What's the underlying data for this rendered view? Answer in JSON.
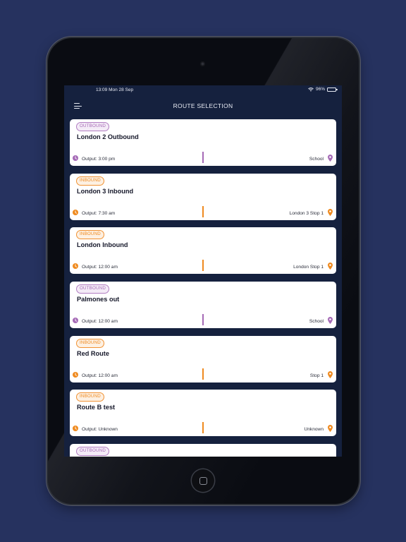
{
  "status_bar": {
    "time": "13:09  Mon 28 Sep",
    "battery": "96%"
  },
  "header": {
    "title": "ROUTE SELECTION"
  },
  "colors": {
    "background": "#26325f",
    "screen": "#15213e",
    "outbound": "#a56ab6",
    "inbound": "#ef8a1f"
  },
  "routes": [
    {
      "direction": "outbound",
      "badge": "OUTBOUND",
      "name": "London 2 Outbound",
      "output": "Output: 3:00 pm",
      "destination": "School"
    },
    {
      "direction": "inbound",
      "badge": "INBOUND",
      "name": "London 3 Inbound",
      "output": "Output: 7:30 am",
      "destination": "London 3 Stop 1"
    },
    {
      "direction": "inbound",
      "badge": "INBOUND",
      "name": "London Inbound",
      "output": "Output: 12:00 am",
      "destination": "London Stop 1"
    },
    {
      "direction": "outbound",
      "badge": "OUTBOUND",
      "name": "Palmones out",
      "output": "Output: 12:00 am",
      "destination": "School"
    },
    {
      "direction": "inbound",
      "badge": "INBOUND",
      "name": "Red Route",
      "output": "Output: 12:00 am",
      "destination": "Stop 1"
    },
    {
      "direction": "inbound",
      "badge": "INBOUND",
      "name": "Route B test",
      "output": "Output: Unknown",
      "destination": "Unknown"
    },
    {
      "direction": "outbound",
      "badge": "OUTBOUND",
      "name": "",
      "output": "",
      "destination": ""
    }
  ],
  "icons": {
    "menu": "menu-icon",
    "clock": "clock-icon",
    "pin": "location-pin-icon",
    "wifi": "wifi-icon",
    "battery": "battery-icon"
  }
}
